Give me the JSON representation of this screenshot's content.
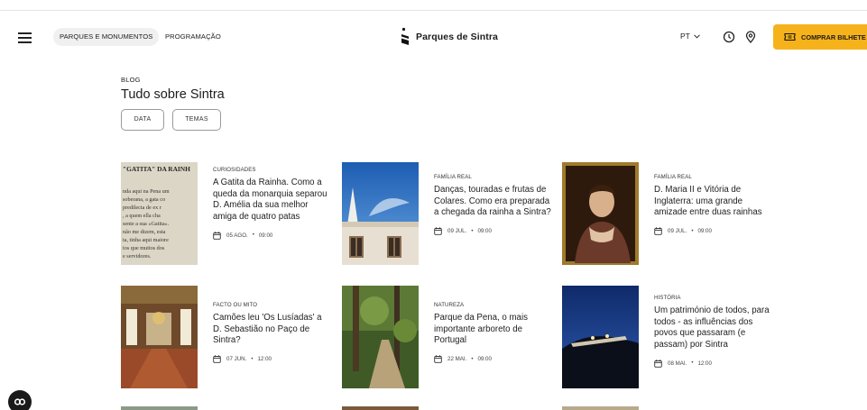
{
  "header": {
    "nav": [
      "PARQUES E MONUMENTOS",
      "PROGRAMAÇÃO"
    ],
    "logo_text": "Parques de Sintra",
    "lang": "PT",
    "buy_label": "COMPRAR BILHETE",
    "accent_color": "#f6b21a"
  },
  "blog": {
    "label": "BLOG",
    "title": "Tudo sobre Sintra",
    "filters": [
      "DATA",
      "TEMAS"
    ]
  },
  "cards": [
    {
      "category": "CURIOSIDADES",
      "title": "A Gatita da Rainha. Como a queda da monarquia separou D. Amélia da sua melhor amiga de quatro patas",
      "date": "05 AGO.",
      "time": "09:00",
      "image": "newspaper-clipping"
    },
    {
      "category": "FAMÍLIA REAL",
      "title": "Danças, touradas e frutas de Colares. Como era preparada a chegada da rainha a Sintra?",
      "date": "09 JUL.",
      "time": "09:00",
      "image": "palace-chimneys"
    },
    {
      "category": "FAMÍLIA REAL",
      "title": "D. Maria II e Vitória de Inglaterra: uma grande amizade entre duas rainhas",
      "date": "09 JUL.",
      "time": "09:00",
      "image": "queen-portrait"
    },
    {
      "category": "FACTO OU MITO",
      "title": "Camões leu 'Os Lusíadas' a D. Sebastião no Paço de Sintra?",
      "date": "07 JUN.",
      "time": "12:00",
      "image": "palace-hall"
    },
    {
      "category": "NATUREZA",
      "title": "Parque da Pena, o mais importante arboreto de Portugal",
      "date": "22 MAI.",
      "time": "09:00",
      "image": "forest-path"
    },
    {
      "category": "HISTÓRIA",
      "title": "Um património de todos, para todos - as influências dos povos que passaram (e passam) por Sintra",
      "date": "08 MAI.",
      "time": "12:00",
      "image": "night-palace"
    }
  ],
  "newspaper_text": "\"GATITA\" DA RAINH nda aqui na Pena um soberana, a gata co predilecta de ex r , a quem ella cha sente a sua «Gatita». não me dizem, esta ta, tinha aqui maiore tos que muitos dos e servidores."
}
